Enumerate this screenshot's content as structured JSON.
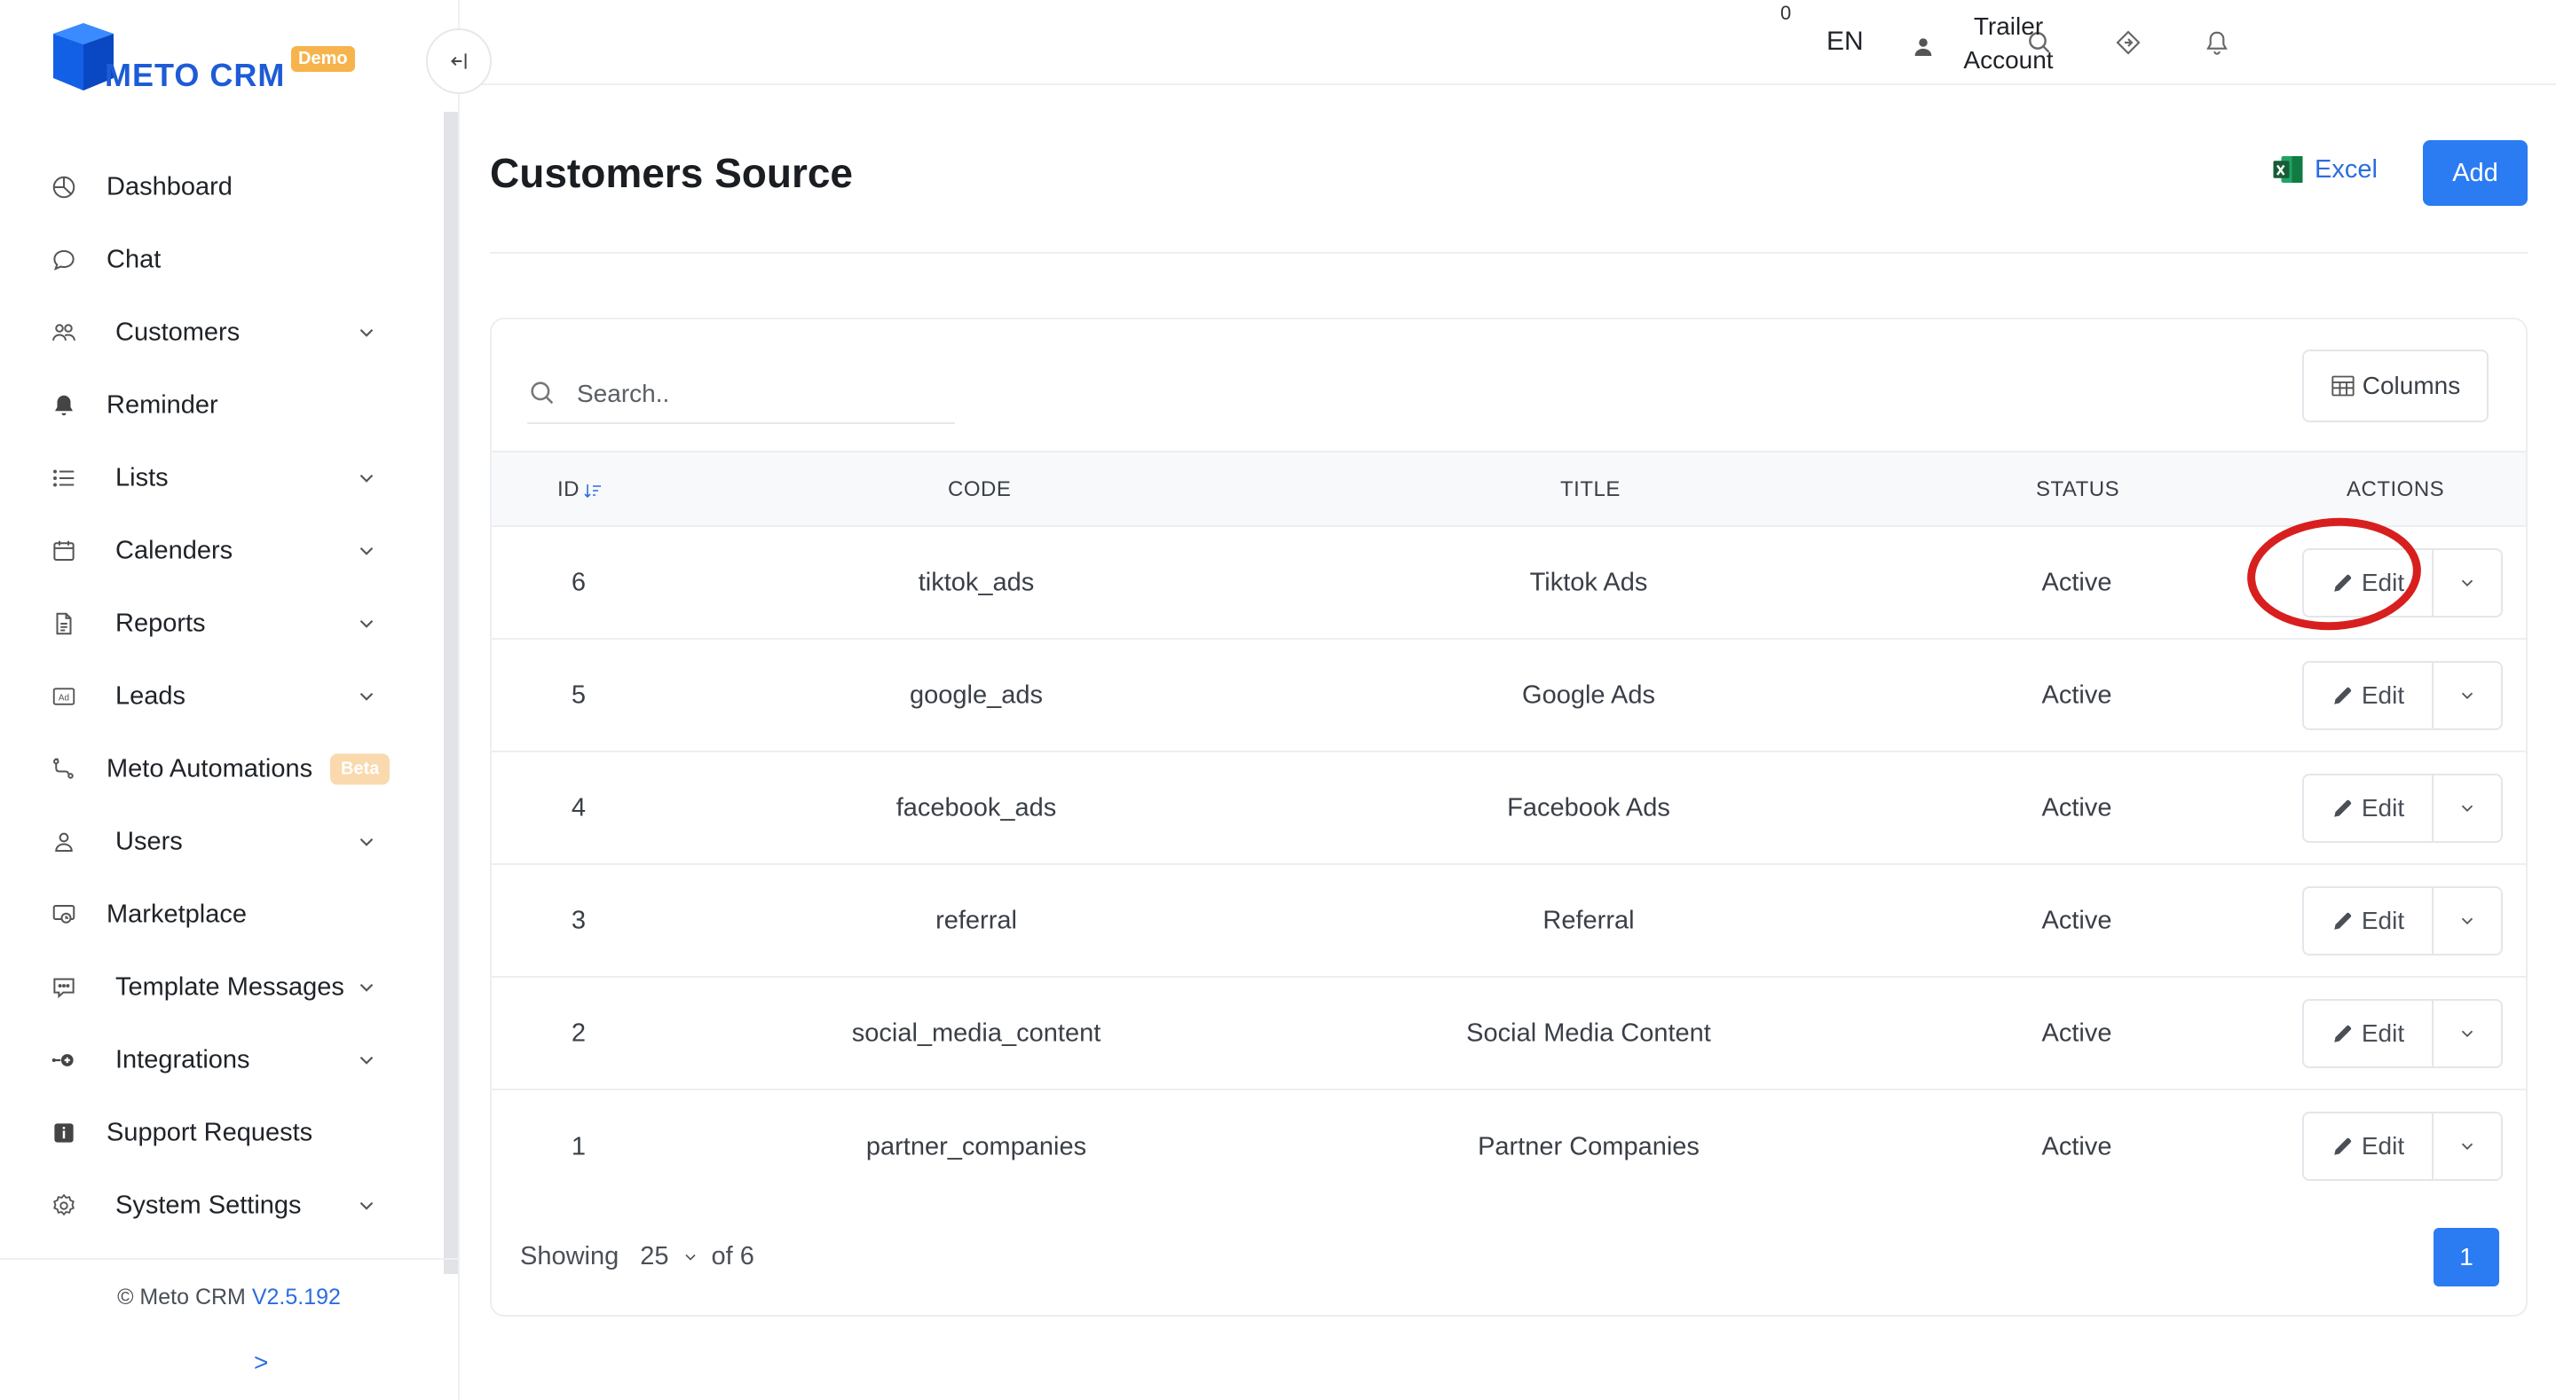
{
  "app": {
    "brand": "METO CRM",
    "badge": "Demo"
  },
  "sidebar": {
    "items": [
      {
        "label": "Dashboard",
        "icon": "dashboard-icon",
        "has_submenu": false
      },
      {
        "label": "Chat",
        "icon": "chat-icon",
        "has_submenu": false
      },
      {
        "label": "Customers",
        "icon": "users-group-icon",
        "has_submenu": true
      },
      {
        "label": "Reminder",
        "icon": "bell-icon",
        "has_submenu": false
      },
      {
        "label": "Lists",
        "icon": "list-icon",
        "has_submenu": true
      },
      {
        "label": "Calenders",
        "icon": "calendar-icon",
        "has_submenu": true
      },
      {
        "label": "Reports",
        "icon": "report-icon",
        "has_submenu": true
      },
      {
        "label": "Leads",
        "icon": "ad-icon",
        "has_submenu": true
      },
      {
        "label": "Meto Automations",
        "icon": "automation-icon",
        "has_submenu": false,
        "badge": "Beta"
      },
      {
        "label": "Users",
        "icon": "user-icon",
        "has_submenu": true
      },
      {
        "label": "Marketplace",
        "icon": "marketplace-icon",
        "has_submenu": false
      },
      {
        "label": "Template Messages",
        "icon": "template-message-icon",
        "has_submenu": true
      },
      {
        "label": "Integrations",
        "icon": "integrations-icon",
        "has_submenu": true
      },
      {
        "label": "Support Requests",
        "icon": "info-icon",
        "has_submenu": false
      },
      {
        "label": "System Settings",
        "icon": "gear-icon",
        "has_submenu": true
      }
    ],
    "footer": {
      "copyright": "© Meto CRM",
      "version": "V2.5.192",
      "expand": ">"
    }
  },
  "topbar": {
    "notification_count": "0",
    "language": "EN",
    "account_line1": "Trailer",
    "account_line2": "Account"
  },
  "page": {
    "title": "Customers Source",
    "excel_label": "Excel",
    "add_label": "Add"
  },
  "table": {
    "search_placeholder": "Search..",
    "columns_label": "Columns",
    "headers": [
      "ID",
      "CODE",
      "TITLE",
      "STATUS",
      "ACTIONS"
    ],
    "rows": [
      {
        "id": "6",
        "code": "tiktok_ads",
        "title": "Tiktok Ads",
        "status": "Active",
        "action": "Edit",
        "highlighted": true
      },
      {
        "id": "5",
        "code": "google_ads",
        "title": "Google Ads",
        "status": "Active",
        "action": "Edit"
      },
      {
        "id": "4",
        "code": "facebook_ads",
        "title": "Facebook Ads",
        "status": "Active",
        "action": "Edit"
      },
      {
        "id": "3",
        "code": "referral",
        "title": "Referral",
        "status": "Active",
        "action": "Edit"
      },
      {
        "id": "2",
        "code": "social_media_content",
        "title": "Social Media Content",
        "status": "Active",
        "action": "Edit"
      },
      {
        "id": "1",
        "code": "partner_companies",
        "title": "Partner Companies",
        "status": "Active",
        "action": "Edit"
      }
    ],
    "footer": {
      "showing": "Showing",
      "page_size": "25",
      "of_total": "of 6",
      "current_page": "1"
    }
  },
  "colors": {
    "accent": "#2b7bf2",
    "brand": "#1e5bd6",
    "highlight_ring": "#d81f1f",
    "demo_badge": "#f7b44c",
    "beta_badge": "#f9d9ad"
  }
}
